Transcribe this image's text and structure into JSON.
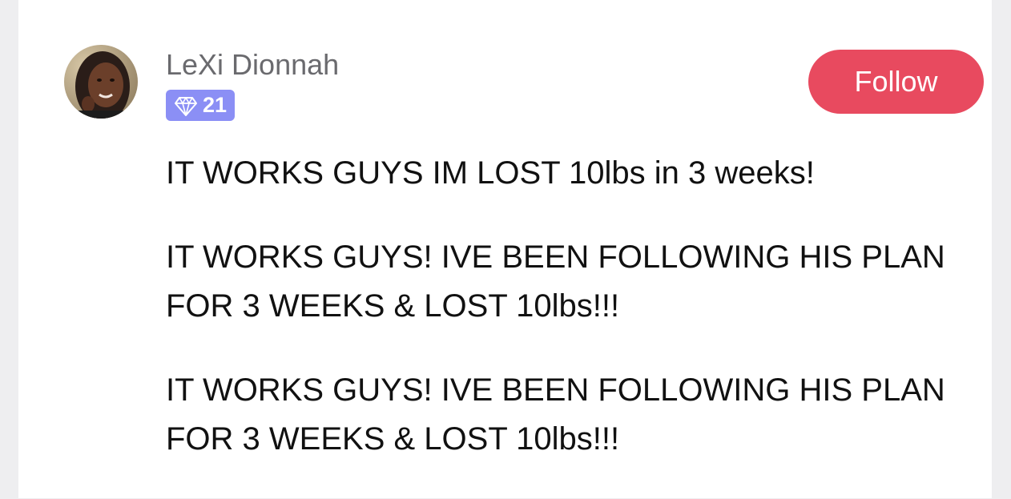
{
  "user": {
    "name": "LeXi Dionnah",
    "badge_count": "21",
    "badge_icon": "diamond-icon",
    "badge_color": "#8b8ff5"
  },
  "follow_button": {
    "label": "Follow",
    "color": "#e84a5f"
  },
  "post": {
    "paragraphs": [
      "IT WORKS GUYS IM LOST 10lbs in 3 weeks!",
      "IT WORKS GUYS! IVE BEEN FOLLOWING HIS PLAN FOR 3 WEEKS & LOST 10lbs!!!",
      "IT WORKS GUYS! IVE BEEN FOLLOWING HIS PLAN FOR 3 WEEKS & LOST 10lbs!!!"
    ]
  }
}
